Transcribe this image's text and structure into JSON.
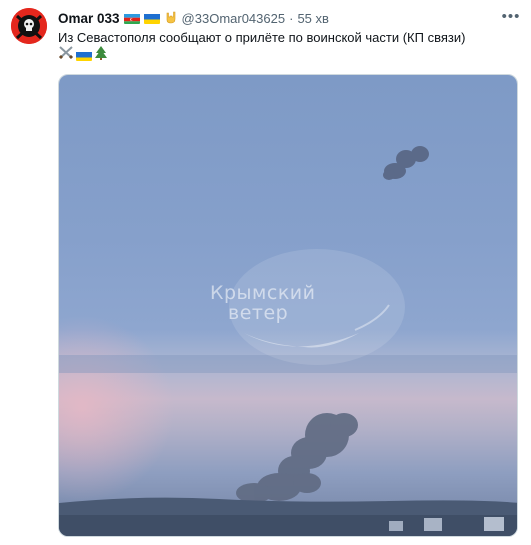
{
  "tweet": {
    "author_name": "Omar 033",
    "handle": "@33Omar043625",
    "separator": "·",
    "time": "55 хв",
    "text": "Из Севастополя сообщают о прилёте по воинской части (КП связи)",
    "more_label": "•••",
    "name_emojis": [
      "flag-azerbaijan-icon",
      "flag-ukraine-icon",
      "rock-hand-icon"
    ],
    "text_emojis": [
      "crossed-swords-icon",
      "flag-ukraine-icon",
      "christmas-tree-icon"
    ]
  },
  "media": {
    "watermark_line1": "Крымский",
    "watermark_line2": "ветер"
  },
  "colors": {
    "text_primary": "#0f1419",
    "text_secondary": "#536471",
    "avatar_bg": "#e4271d",
    "border": "#cfd9de"
  }
}
